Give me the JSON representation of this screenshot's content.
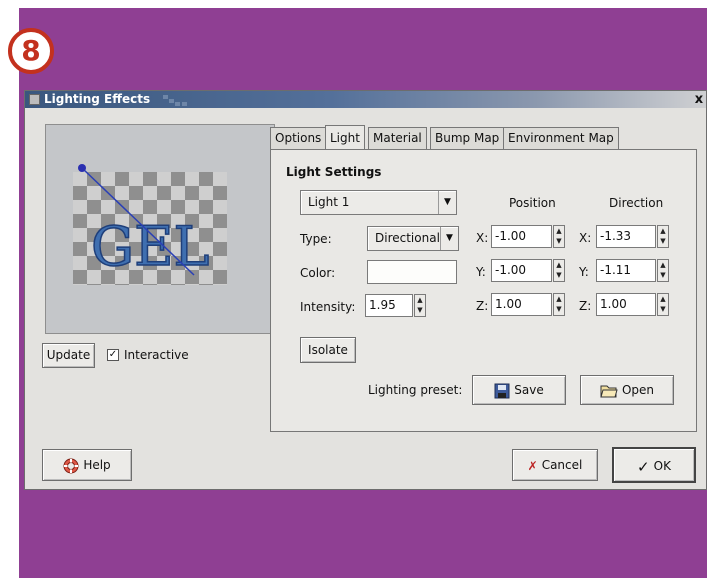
{
  "step_badge": "8",
  "colors": {
    "frame": "#8f3f93",
    "badge": "#c3311e",
    "titlebar": "#3a577e"
  },
  "window": {
    "title": "Lighting Effects",
    "close": "x"
  },
  "preview": {
    "text": "GEL"
  },
  "update_button": "Update",
  "interactive": {
    "label": "Interactive",
    "checked": true,
    "mark": "✓"
  },
  "tabs": [
    "Options",
    "Light",
    "Material",
    "Bump Map",
    "Environment Map"
  ],
  "active_tab": "Light",
  "light": {
    "heading": "Light Settings",
    "light_select": "Light 1",
    "type_label": "Type:",
    "type_value": "Directional",
    "color_label": "Color:",
    "intensity_label": "Intensity:",
    "intensity_value": "1.95",
    "isolate": "Isolate",
    "position_header": "Position",
    "direction_header": "Direction",
    "position": {
      "x_label": "X:",
      "x": "-1.00",
      "y_label": "Y:",
      "y": "-1.00",
      "z_label": "Z:",
      "z": "1.00"
    },
    "direction": {
      "x_label": "X:",
      "x": "-1.33",
      "y_label": "Y:",
      "y": "-1.11",
      "z_label": "Z:",
      "z": "1.00"
    },
    "preset_label": "Lighting preset:",
    "save": "Save",
    "open": "Open"
  },
  "footer": {
    "help": "Help",
    "cancel": "Cancel",
    "ok": "OK"
  }
}
